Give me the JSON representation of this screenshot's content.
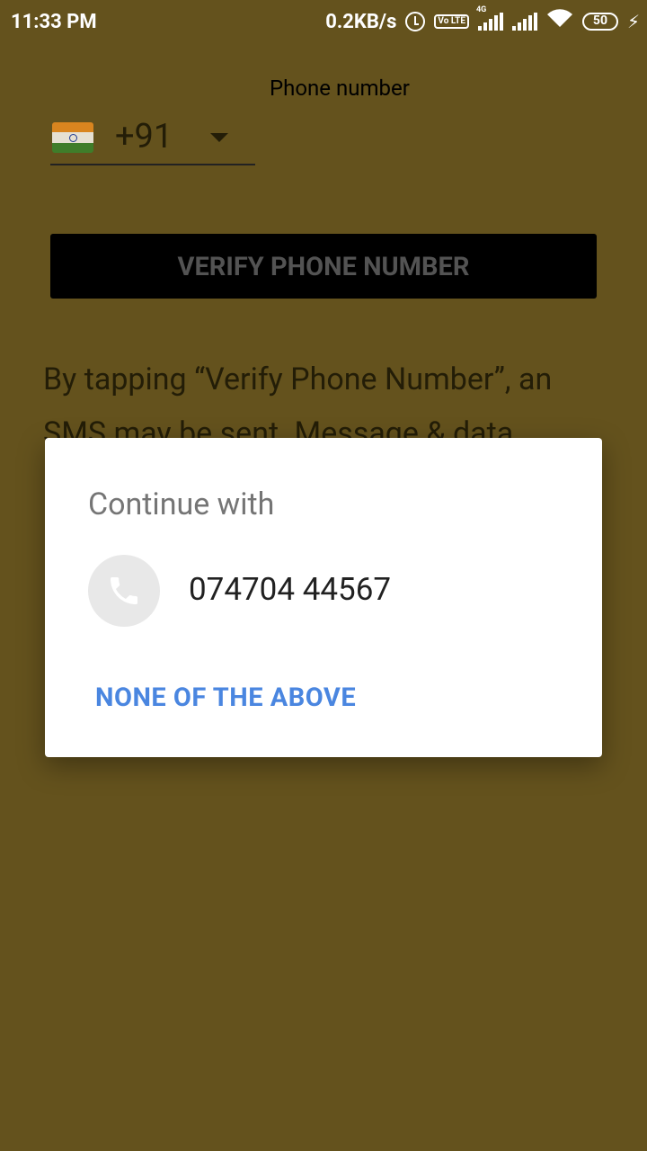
{
  "status_bar": {
    "time": "11:33 PM",
    "net_speed": "0.2KB/s",
    "volte": "Vo LTE",
    "network_type": "4G",
    "battery": "50",
    "icons": [
      "alarm-icon",
      "volte-icon",
      "signal-icon",
      "signal-icon",
      "wifi-icon",
      "battery-icon",
      "charging-icon"
    ]
  },
  "page": {
    "title": "Phone number",
    "country_code": "+91",
    "verify_button_label": "VERIFY PHONE NUMBER",
    "disclaimer": "By tapping “Verify Phone Number”, an SMS may be sent. Message & data"
  },
  "dialog": {
    "title": "Continue with",
    "phone_number": "074704 44567",
    "none_label": "NONE OF THE ABOVE"
  },
  "colors": {
    "scrim_background": "#64521d",
    "button_background": "#000000",
    "link_blue": "#4a86e0"
  }
}
